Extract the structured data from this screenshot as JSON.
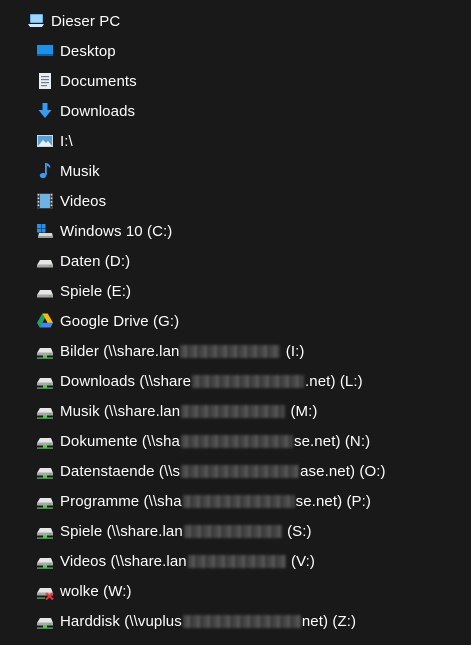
{
  "tree": {
    "root": {
      "label": "Dieser PC",
      "icon": "this-pc-icon"
    },
    "items": [
      {
        "label": "Desktop",
        "icon": "desktop-folder-icon"
      },
      {
        "label": "Documents",
        "icon": "documents-folder-icon"
      },
      {
        "label": "Downloads",
        "icon": "downloads-folder-icon"
      },
      {
        "label": "I:\\",
        "icon": "pictures-folder-icon"
      },
      {
        "label": "Musik",
        "icon": "music-folder-icon"
      },
      {
        "label": "Videos",
        "icon": "videos-folder-icon"
      },
      {
        "label": "Windows 10 (C:)",
        "icon": "windows-drive-icon"
      },
      {
        "label": "Daten (D:)",
        "icon": "local-drive-icon"
      },
      {
        "label": "Spiele (E:)",
        "icon": "local-drive-icon"
      },
      {
        "label": "Google Drive (G:)",
        "icon": "google-drive-icon"
      },
      {
        "prefix": "Bilder (\\\\share.lan",
        "suffix": " (I:)",
        "icon": "network-drive-icon"
      },
      {
        "prefix": "Downloads (\\\\share",
        "suffix": ".net) (L:)",
        "icon": "network-drive-icon"
      },
      {
        "prefix": "Musik (\\\\share.lan",
        "suffix": " (M:)",
        "icon": "network-drive-icon"
      },
      {
        "prefix": "Dokumente (\\\\sha",
        "suffix": "se.net) (N:)",
        "icon": "network-drive-icon"
      },
      {
        "prefix": "Datenstaende (\\\\s",
        "suffix": "ase.net) (O:)",
        "icon": "network-drive-icon"
      },
      {
        "prefix": "Programme (\\\\sha",
        "suffix": "se.net) (P:)",
        "icon": "network-drive-icon"
      },
      {
        "prefix": "Spiele (\\\\share.lan",
        "suffix": " (S:)",
        "icon": "network-drive-icon"
      },
      {
        "prefix": "Videos (\\\\share.lan",
        "suffix": " (V:)",
        "icon": "network-drive-icon"
      },
      {
        "label": "wolke (W:)",
        "icon": "disconnected-network-drive-icon"
      },
      {
        "prefix": "Harddisk (\\\\vuplus",
        "suffix": "net) (Z:)",
        "icon": "network-drive-icon"
      }
    ]
  }
}
